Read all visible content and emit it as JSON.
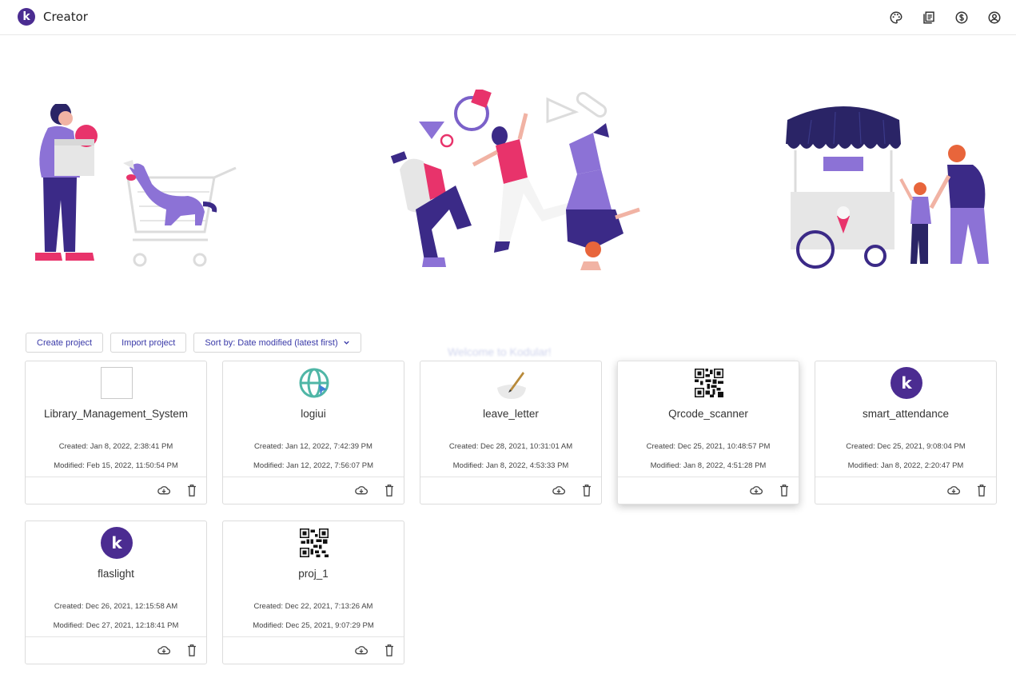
{
  "header": {
    "brand_letter": "k",
    "title": "Creator",
    "icons": [
      "palette-icon",
      "docs-icon",
      "dollar-icon",
      "account-icon"
    ]
  },
  "toolbar": {
    "create_label": "Create project",
    "import_label": "Import project",
    "sort_label": "Sort by: Date modified (latest first)"
  },
  "watermark": "Welcome to Kodular!",
  "colors": {
    "brand": "#4b2c91",
    "accent": "#7b61c9",
    "pink": "#e8336b",
    "link": "#3a3aa8"
  },
  "projects": [
    {
      "name": "Library_Management_System",
      "created": "Created: Jan 8, 2022, 2:38:41 PM",
      "modified": "Modified: Feb 15, 2022, 11:50:54 PM",
      "thumb": "broken-image"
    },
    {
      "name": "logiui",
      "created": "Created: Jan 12, 2022, 7:42:39 PM",
      "modified": "Modified: Jan 12, 2022, 7:56:07 PM",
      "thumb": "globe-icon"
    },
    {
      "name": "leave_letter",
      "created": "Created: Dec 28, 2021, 10:31:01 AM",
      "modified": "Modified: Jan 8, 2022, 4:53:33 PM",
      "thumb": "quill-icon"
    },
    {
      "name": "Qrcode_scanner",
      "created": "Created: Dec 25, 2021, 10:48:57 PM",
      "modified": "Modified: Jan 8, 2022, 4:51:28 PM",
      "thumb": "qr-icon"
    },
    {
      "name": "smart_attendance",
      "created": "Created: Dec 25, 2021, 9:08:04 PM",
      "modified": "Modified: Jan 8, 2022, 2:20:47 PM",
      "thumb": "kodular-k-icon"
    },
    {
      "name": "flaslight",
      "created": "Created: Dec 26, 2021, 12:15:58 AM",
      "modified": "Modified: Dec 27, 2021, 12:18:41 PM",
      "thumb": "kodular-k-icon"
    },
    {
      "name": "proj_1",
      "created": "Created: Dec 22, 2021, 7:13:26 AM",
      "modified": "Modified: Dec 25, 2021, 9:07:29 PM",
      "thumb": "qr-icon"
    }
  ]
}
